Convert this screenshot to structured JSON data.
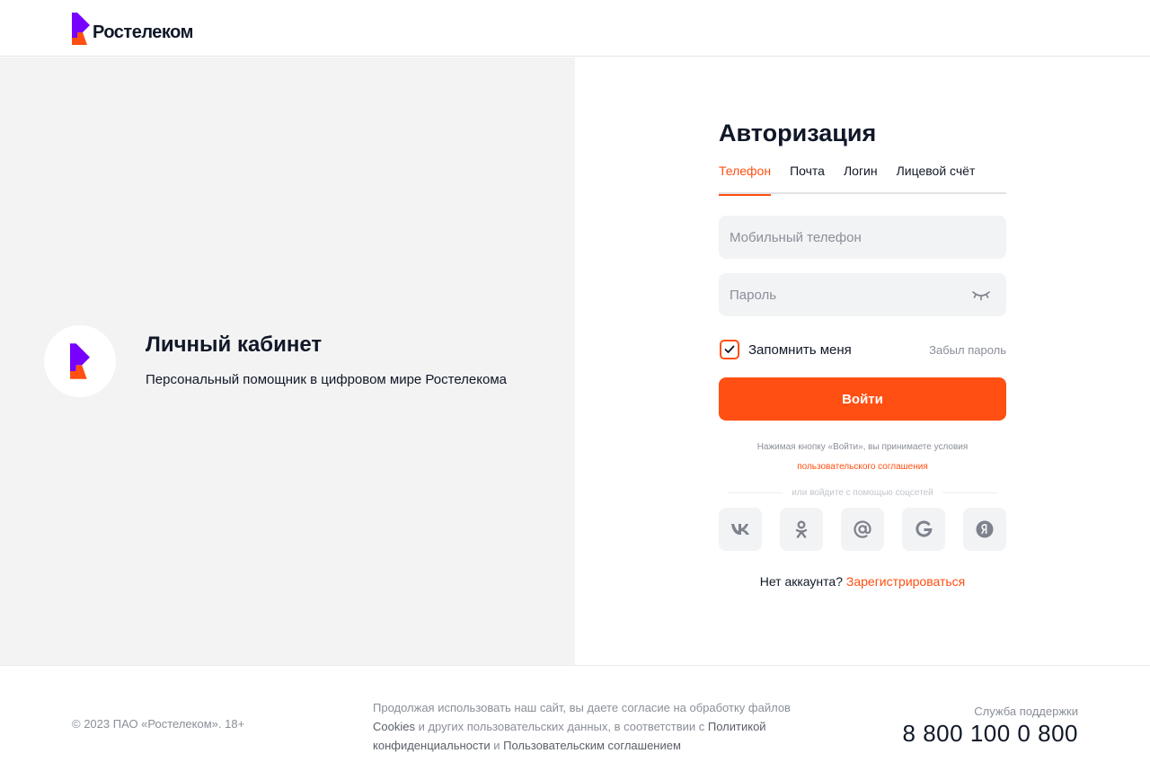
{
  "header": {
    "brand_name": "Ростелеком"
  },
  "promo": {
    "title": "Личный кабинет",
    "subtitle": "Персональный помощник в цифровом мире Ростелекома"
  },
  "form": {
    "title": "Авторизация",
    "tabs": [
      {
        "label": "Телефон",
        "active": true
      },
      {
        "label": "Почта",
        "active": false
      },
      {
        "label": "Логин",
        "active": false
      },
      {
        "label": "Лицевой счёт",
        "active": false
      }
    ],
    "phone_placeholder": "Мобильный телефон",
    "password_placeholder": "Пароль",
    "remember_label": "Запомнить меня",
    "remember_checked": true,
    "forgot_label": "Забыл пароль",
    "submit_label": "Войти",
    "terms_text": "Нажимая кнопку «Войти», вы принимаете условия",
    "terms_link": "пользовательского соглашения",
    "social_divider": "или войдите с помощью соцсетей",
    "socials": [
      "vk-icon",
      "ok-icon",
      "mail-icon",
      "google-icon",
      "yandex-icon"
    ],
    "no_account": "Нет аккаунта?",
    "register_link": "Зарегистрироваться"
  },
  "footer": {
    "copyright": "© 2023 ПАО «Ростелеком». 18+",
    "legal_1": "Продолжая использовать наш сайт, вы даете согласие на обработку файлов",
    "legal_cookies": "Cookies",
    "legal_2": "и других пользовательских данных, в соответствии с",
    "legal_privacy": "Политикой конфиденциальности",
    "legal_and": "и",
    "legal_agreement": "Пользовательским соглашением",
    "support_label": "Служба поддержки",
    "support_phone": "8 800 100 0 800"
  },
  "colors": {
    "accent": "#ff4f12",
    "brand_purple": "#7700ff",
    "panel_bg": "#f3f3f3"
  }
}
